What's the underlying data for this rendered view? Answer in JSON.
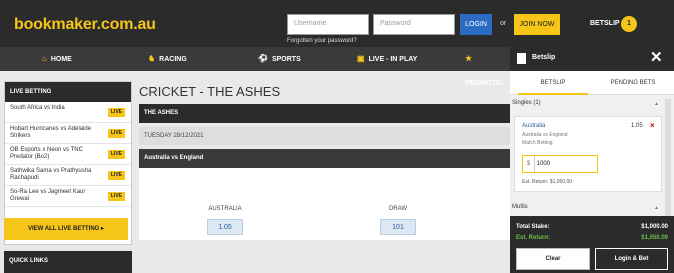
{
  "header": {
    "logo": "bookmaker.com.au",
    "username_placeholder": "Username",
    "password_placeholder": "Password",
    "login_label": "LOGIN",
    "or": "or",
    "join_label": "JOIN NOW",
    "forgot_link": "Forgotten your password?",
    "betslip_label": "BETSLIP",
    "betslip_count": "1"
  },
  "nav": [
    {
      "label": "HOME",
      "icon": "house-icon",
      "glyph": "⌂"
    },
    {
      "label": "RACING",
      "icon": "horse-icon",
      "glyph": "♞"
    },
    {
      "label": "SPORTS",
      "icon": "sports-icon",
      "glyph": "⚽"
    },
    {
      "label": "LIVE - IN PLAY",
      "icon": "live-icon",
      "glyph": "▣"
    },
    {
      "label": "PROMOTIC",
      "icon": "promotions-icon",
      "glyph": "★"
    }
  ],
  "live_betting": {
    "heading": "LIVE BETTING",
    "badge": "LIVE",
    "items": [
      "South Africa vs India",
      "Hobart Hurricanes vs Adelaide Strikers",
      "OB Esports x Neon vs TNC Predator (Bo2)",
      "Sathwika Sama vs Prathyusha Rachapudi",
      "So-Ra Lee vs Jagmeet Kaur Grewal"
    ],
    "view_all": "VIEW ALL LIVE BETTING"
  },
  "quick_links": "QUICK LINKS",
  "main": {
    "title": "CRICKET - THE ASHES",
    "market": "THE ASHES",
    "date": "TUESDAY 28/12/2021",
    "event": "Australia vs England",
    "odds": [
      {
        "label": "AUSTRALIA",
        "price": "1.05"
      },
      {
        "label": "DRAW",
        "price": "101"
      }
    ]
  },
  "betslip": {
    "title": "Betslip",
    "close": "✕",
    "tabs": [
      "BETSLIP",
      "PENDING BETS"
    ],
    "singles": "Singles (1)",
    "selection": "Australia",
    "odds": "1.05",
    "remove": "×",
    "event": "Australia vs England",
    "market": "Match Betting",
    "currency": "$",
    "stake": "1000",
    "est_return": "Est. Return: $1,050.00",
    "multis": "Multis",
    "total_stake_label": "Total Stake:",
    "total_stake": "$1,000.00",
    "est_return_label": "Est. Return:",
    "est_return_total": "$1,050.00",
    "clear_label": "Clear",
    "login_bet_label": "Login & Bet"
  }
}
